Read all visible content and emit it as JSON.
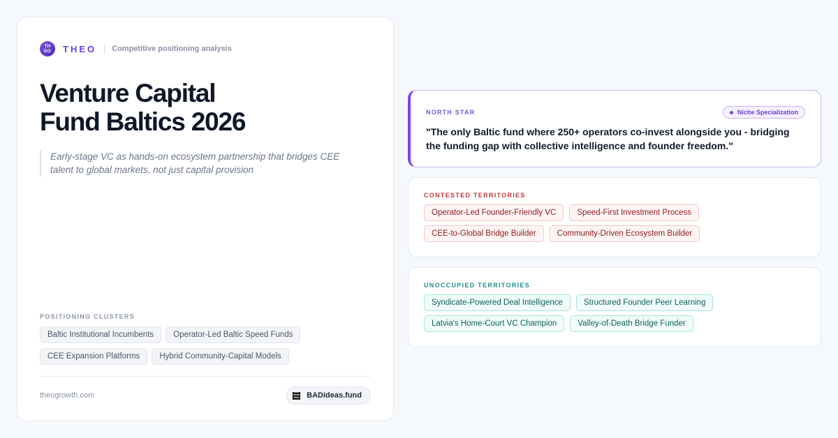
{
  "brand": {
    "logo_text_line1": "TH",
    "logo_text_line2": "EO",
    "name": "THEO",
    "tagline": "Competitive positioning analysis"
  },
  "title": {
    "line1": "Venture Capital",
    "line2": "Fund Baltics 2026"
  },
  "tagline": "Early-stage VC as hands-on ecosystem partnership that bridges CEE talent to global markets, not just capital provision",
  "clusters": {
    "label": "POSITIONING CLUSTERS",
    "items": [
      "Baltic Institutional Incumbents",
      "Operator-Led Baltic Speed Funds",
      "CEE Expansion Platforms",
      "Hybrid Community-Capital Models"
    ]
  },
  "footer": {
    "site": "theogrowth.com",
    "badge_logo_line1": "BAD",
    "badge_logo_line2": "ideas",
    "badge_logo_line3": "fund",
    "badge_label": "BADideas.fund"
  },
  "north_star": {
    "label": "NORTH STAR",
    "pill": "Niche Specialization",
    "quote": "\"The only Baltic fund where 250+ operators co-invest alongside you - bridging the funding gap with collective intelligence and founder freedom.\""
  },
  "contested": {
    "label": "CONTESTED TERRITORIES",
    "items": [
      "Operator-Led Founder-Friendly VC",
      "Speed-First Investment Process",
      "CEE-to-Global Bridge Builder",
      "Community-Driven Ecosystem Builder"
    ]
  },
  "unoccupied": {
    "label": "UNOCCUPIED TERRITORIES",
    "items": [
      "Syndicate-Powered Deal Intelligence",
      "Structured Founder Peer Learning",
      "Latvia's Home-Court VC Champion",
      "Valley-of-Death Bridge Funder"
    ]
  },
  "colors": {
    "brand_purple": "#6b3fd8",
    "accent_purple": "#7a45e6",
    "contested_red": "#c0353a",
    "unoccupied_teal": "#1d8f89",
    "background": "#f5f8fc"
  },
  "icons": {
    "brand_logo": "theo-logo-icon",
    "badge_logo": "badideas-logo-icon",
    "pill_dot": "dot-icon"
  }
}
